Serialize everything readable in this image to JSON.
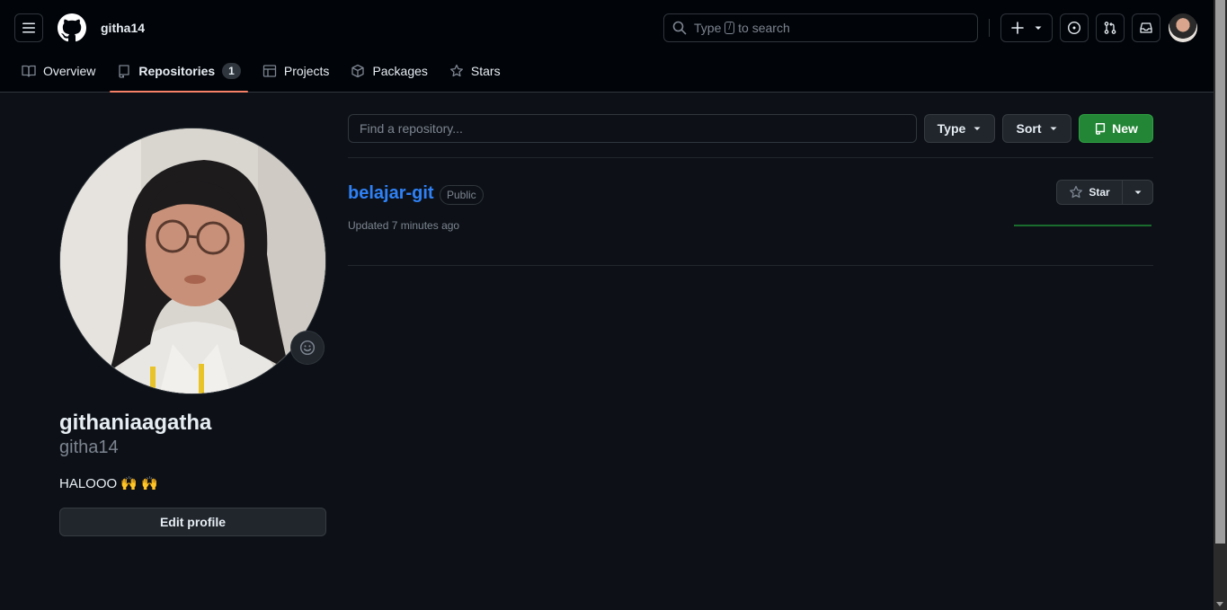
{
  "header": {
    "username": "githa14",
    "search_prefix": "Type",
    "search_key": "/",
    "search_suffix": "to search"
  },
  "tabs": [
    {
      "label": "Overview",
      "icon": "book-icon"
    },
    {
      "label": "Repositories",
      "icon": "repo-icon",
      "count": "1",
      "active": true
    },
    {
      "label": "Projects",
      "icon": "table-icon"
    },
    {
      "label": "Packages",
      "icon": "package-icon"
    },
    {
      "label": "Stars",
      "icon": "star-icon"
    }
  ],
  "profile": {
    "full_name": "githaniaagatha",
    "login": "githa14",
    "bio": "HALOOO 🙌 🙌",
    "edit_label": "Edit profile"
  },
  "filters": {
    "find_placeholder": "Find a repository...",
    "type_label": "Type",
    "sort_label": "Sort",
    "new_label": "New"
  },
  "repos": [
    {
      "name": "belajar-git",
      "visibility": "Public",
      "updated": "Updated 7 minutes ago",
      "star_label": "Star"
    }
  ],
  "colors": {
    "bg": "#0d1117",
    "header_bg": "#010409",
    "accent_link": "#2f81f7",
    "tab_underline": "#f78166",
    "primary_button": "#238636"
  }
}
